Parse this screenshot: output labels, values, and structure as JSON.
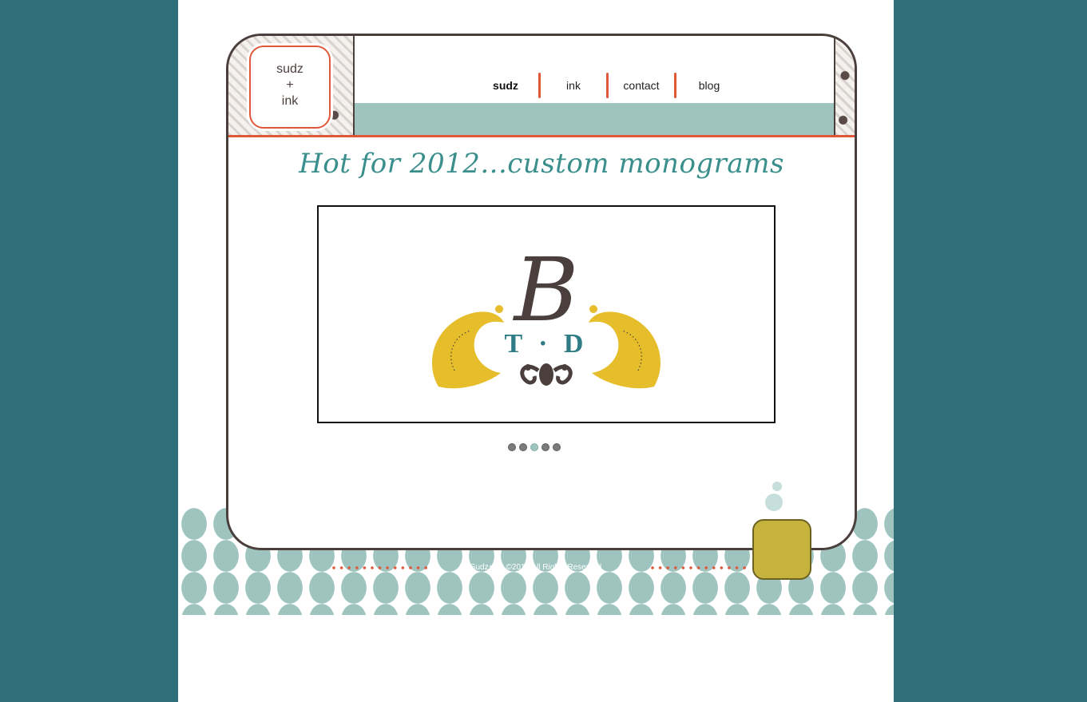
{
  "logo": {
    "line1": "sudz",
    "line2": "+",
    "line3": "ink"
  },
  "nav": {
    "items": [
      {
        "label": "sudz",
        "active": true
      },
      {
        "label": "ink",
        "active": false
      },
      {
        "label": "contact",
        "active": false
      },
      {
        "label": "blog",
        "active": false
      }
    ]
  },
  "headline": "Hot for 2012...custom monograms",
  "slide": {
    "monogram_initial": "B",
    "monogram_sub": "T · D",
    "total_slides": 5,
    "active_index": 2
  },
  "footer": {
    "copyright": "Sudz+Ink ©2012 All Rights Reserved"
  },
  "colors": {
    "background": "#2e6f79",
    "accent": "#e0583a",
    "teal_light": "#9fc4bf",
    "headline": "#3a8f8c",
    "gold": "#e6bd2b",
    "brown": "#4a3f3c"
  }
}
